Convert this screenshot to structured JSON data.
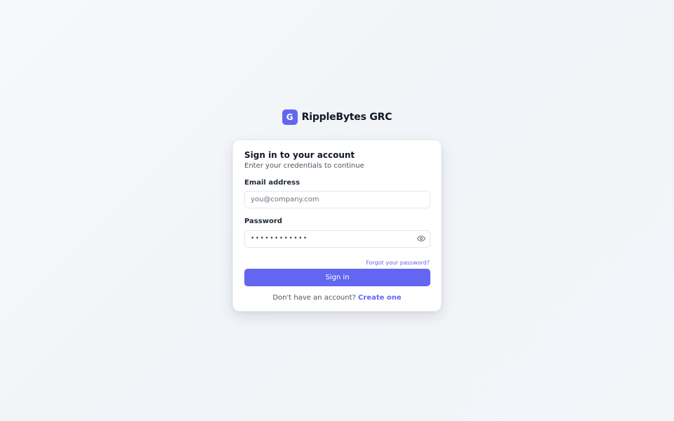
{
  "brand": {
    "logo_letter": "G",
    "name": "RippleBytes GRC",
    "accent_color": "#6366f1"
  },
  "card": {
    "title": "Sign in to your account",
    "subtitle": "Enter your credentials to continue"
  },
  "form": {
    "email": {
      "label": "Email address",
      "placeholder": "you@company.com",
      "value": ""
    },
    "password": {
      "label": "Password",
      "value": "••••••••••••",
      "toggle_icon": "eye-icon"
    },
    "forgot_label": "Forgot your password?",
    "submit_label": "Sign in"
  },
  "signup": {
    "prompt": "Don't have an account?",
    "link_label": "Create one"
  }
}
